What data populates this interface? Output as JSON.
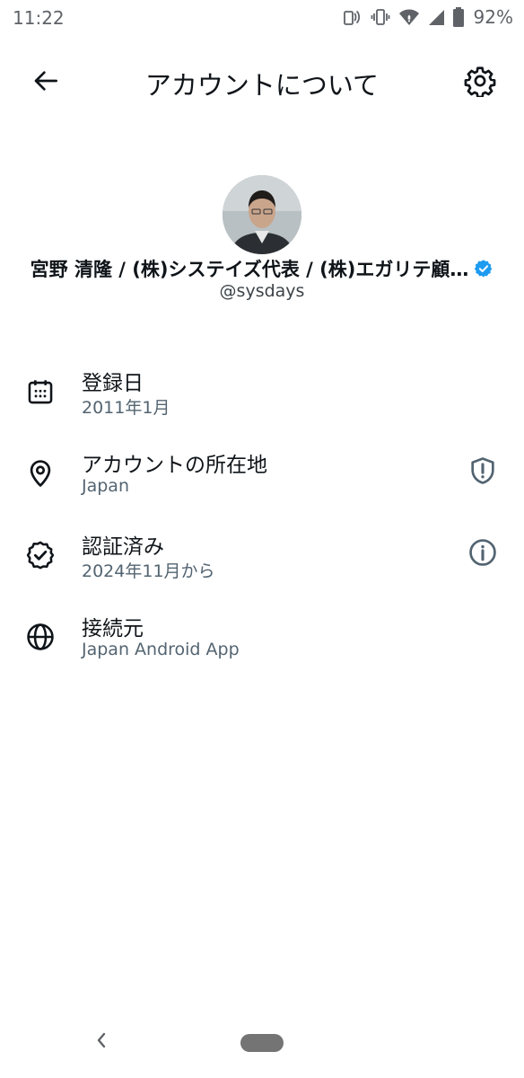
{
  "status_bar": {
    "time": "11:22",
    "battery_percent": "92%",
    "icons": [
      "nfc-icon",
      "vibrate-icon",
      "wifi-icon",
      "cell-signal-icon",
      "battery-icon"
    ]
  },
  "header": {
    "title": "アカウントについて",
    "back_icon": "arrow-left-icon",
    "settings_icon": "gear-icon"
  },
  "profile": {
    "display_name": "宮野 清隆 / (株)システイズ代表 / (株)エガリテ顧…",
    "handle": "@sysdays",
    "verified": true,
    "verified_color": "#1d9bf0"
  },
  "rows": [
    {
      "icon": "calendar-icon",
      "title": "登録日",
      "subtitle": "2011年1月",
      "trailing_icon": ""
    },
    {
      "icon": "location-pin-icon",
      "title": "アカウントの所在地",
      "subtitle": "Japan",
      "trailing_icon": "shield-alert-icon"
    },
    {
      "icon": "verified-check-icon",
      "title": "認証済み",
      "subtitle": "2024年11月から",
      "trailing_icon": "info-icon"
    },
    {
      "icon": "globe-icon",
      "title": "接続元",
      "subtitle": "Japan Android App",
      "trailing_icon": ""
    }
  ],
  "nav": {
    "back_icon": "chevron-left-icon",
    "home_icon": "home-pill-icon"
  },
  "colors": {
    "text_primary": "#0f1419",
    "text_secondary": "#536471",
    "icon_color": "#0f1419",
    "trailing_icon_color": "#536471"
  }
}
